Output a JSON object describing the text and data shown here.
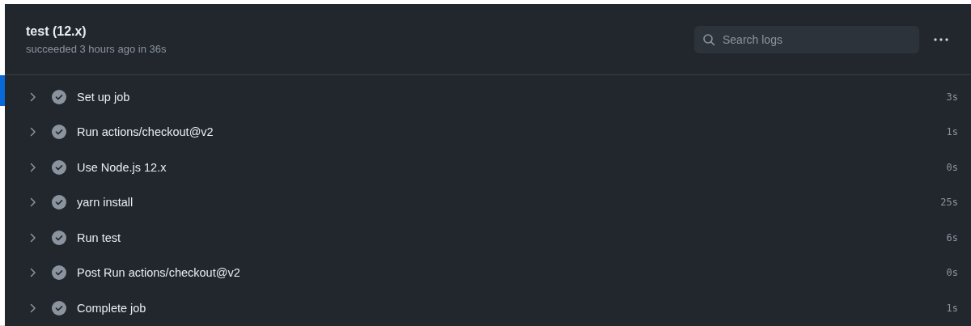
{
  "job": {
    "title": "test (12.x)",
    "summary": "succeeded 3 hours ago in 36s"
  },
  "search": {
    "placeholder": "Search logs"
  },
  "steps": [
    {
      "name": "Set up job",
      "duration": "3s",
      "kind": "success",
      "expanded": false
    },
    {
      "name": "Run actions/checkout@v2",
      "duration": "1s",
      "kind": "success",
      "expanded": false
    },
    {
      "name": "Use Node.js 12.x",
      "duration": "0s",
      "kind": "success",
      "expanded": false
    },
    {
      "name": "yarn install",
      "duration": "25s",
      "kind": "success",
      "expanded": false
    },
    {
      "name": "Run test",
      "duration": "6s",
      "kind": "success",
      "expanded": false
    },
    {
      "name": "Post Run actions/checkout@v2",
      "duration": "0s",
      "kind": "success",
      "expanded": false
    },
    {
      "name": "Complete job",
      "duration": "1s",
      "kind": "success",
      "expanded": false
    }
  ]
}
